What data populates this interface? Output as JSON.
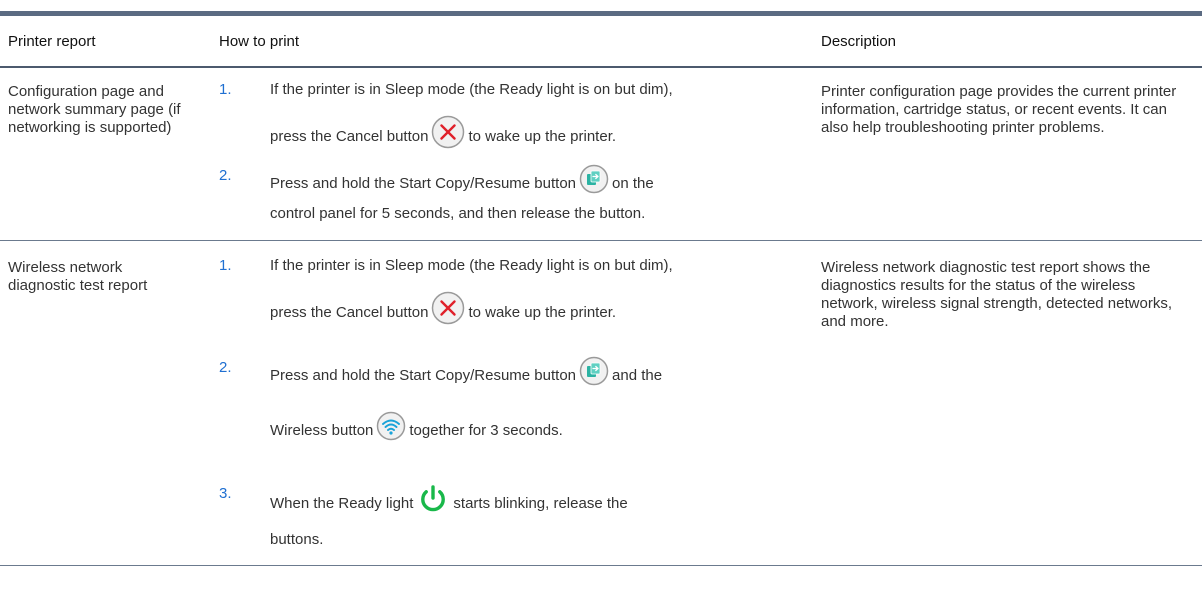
{
  "table": {
    "headers": [
      "Printer report",
      "How to print",
      "Description"
    ],
    "rows": [
      {
        "report": "Configuration page and network summary page (if networking is supported)",
        "steps": [
          {
            "num": "1.",
            "line1": "If the printer is in Sleep mode (the Ready light is on but dim),",
            "line2_before": "press the Cancel button",
            "line2_after": "to wake up the printer."
          },
          {
            "num": "2.",
            "line1_before": "Press and hold the Start Copy/Resume button",
            "line1_after": "on the",
            "line2": "control panel for 5 seconds, and then release the button."
          }
        ],
        "description": "Printer configuration page provides the current printer information, cartridge status, or recent events. It can also help troubleshooting printer problems."
      },
      {
        "report": "Wireless network diagnostic test report",
        "steps": [
          {
            "num": "1.",
            "line1": "If the printer is in Sleep mode (the Ready light is on but dim),",
            "line2_before": "press the Cancel button",
            "line2_after": "to wake up the printer."
          },
          {
            "num": "2.",
            "line1_before": "Press and hold the Start Copy/Resume button",
            "line1_after": "and the",
            "line2_before": "Wireless button",
            "line2_after": "together for 3 seconds."
          },
          {
            "num": "3.",
            "line1_before": "When the Ready light",
            "line1_after": "starts blinking, release the",
            "line2": "buttons."
          }
        ],
        "description": "Wireless network diagnostic test report shows the diagnostics results for the status of the wireless network, wireless signal strength, detected networks, and more."
      }
    ]
  },
  "icons": {
    "cancel": "cancel-x-icon",
    "start_copy": "start-copy-resume-icon",
    "wireless": "wireless-icon",
    "power": "power-icon"
  },
  "colors": {
    "rule": "#5b6b82",
    "step_number": "#1f6fd1",
    "cancel_x": "#e0202a",
    "copy_teal": "#2bb3a3",
    "wireless_blue": "#1aa3d8",
    "power_green": "#19b84a"
  }
}
